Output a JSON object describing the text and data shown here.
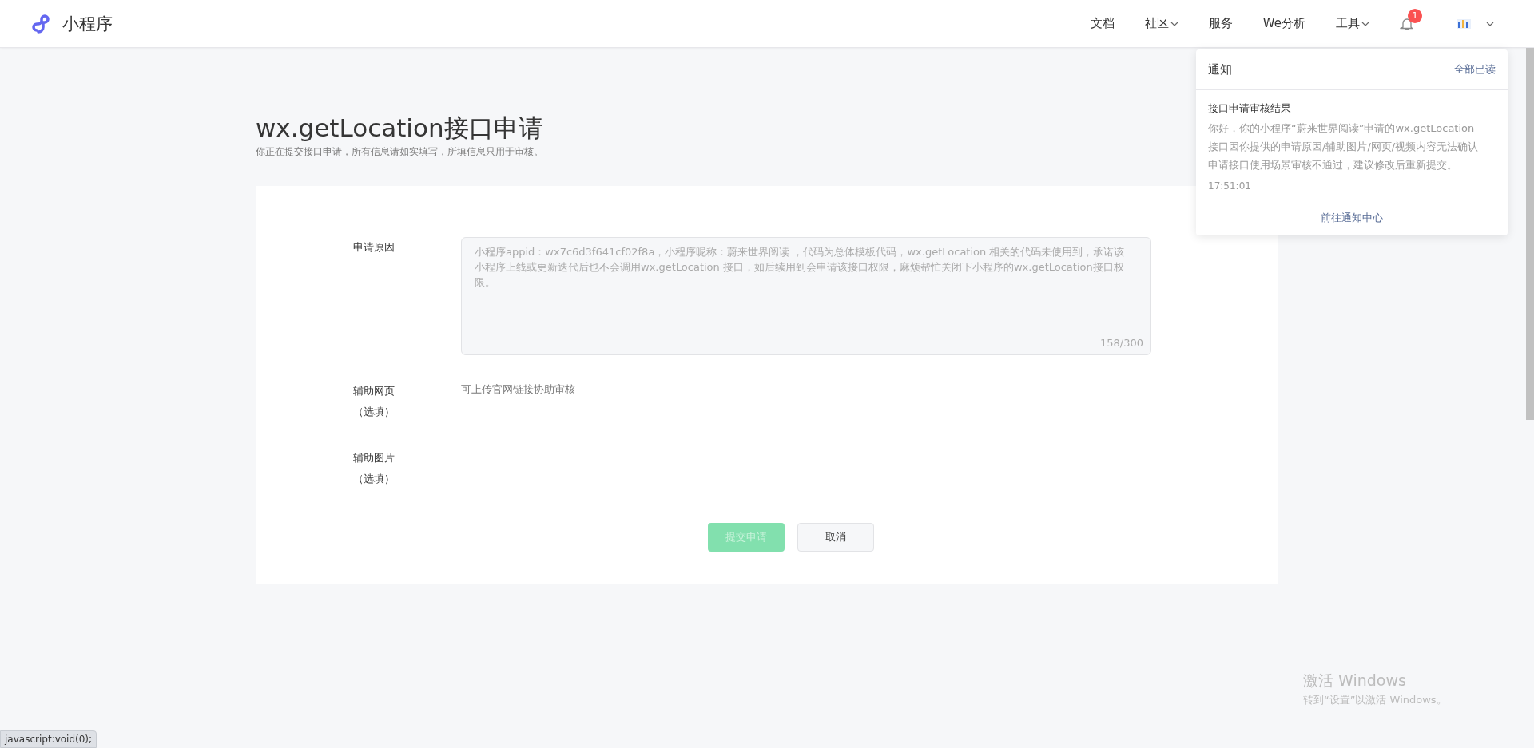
{
  "header": {
    "logo_text": "小程序",
    "nav": [
      {
        "label": "文档",
        "dropdown": false
      },
      {
        "label": "社区",
        "dropdown": true
      },
      {
        "label": "服务",
        "dropdown": false
      },
      {
        "label": "We分析",
        "dropdown": false
      },
      {
        "label": "工具",
        "dropdown": true
      }
    ],
    "notification_badge": "1"
  },
  "page": {
    "title": "wx.getLocation接口申请",
    "subtitle": "你正在提交接口申请，所有信息请如实填写，所填信息只用于审核。"
  },
  "form": {
    "fields": [
      {
        "kind": "textarea",
        "label": "申请原因",
        "value": "小程序appid：wx7c6d3f641cf02f8a，小程序昵称：蔚来世界阅读 ，代码为总体模板代码，wx.getLocation 相关的代码未使用到，承诺该小程序上线或更新迭代后也不会调用wx.getLocation 接口，如后续用到会申请该接口权限，麻烦帮忙关闭下小程序的wx.getLocation接口权限。",
        "counter": "158/300",
        "disabled": true
      },
      {
        "kind": "hint",
        "label": "辅助网页",
        "note": "（选填）",
        "hint": "可上传官网链接协助审核"
      },
      {
        "kind": "upload",
        "label": "辅助图片",
        "note": "（选填）"
      }
    ],
    "buttons": [
      {
        "label": "提交申请",
        "primary": true,
        "disabled": true
      },
      {
        "label": "取消",
        "primary": false
      }
    ]
  },
  "notifications": {
    "title": "通知",
    "mark_all_read": "全部已读",
    "items": [
      {
        "title": "接口申请审核结果",
        "body": "你好，你的小程序“蔚来世界阅读”申请的wx.getLocation接口因你提供的申请原因/辅助图片/网页/视频内容无法确认申请接口使用场景审核不通过，建议修改后重新提交。",
        "time": "17:51:01"
      }
    ],
    "footer_link": "前往通知中心"
  },
  "status_bar": {
    "url": "javascript:void(0);"
  },
  "os_overlay": {
    "title": "激活 Windows",
    "subtitle": "转到“设置”以激活 Windows。"
  }
}
